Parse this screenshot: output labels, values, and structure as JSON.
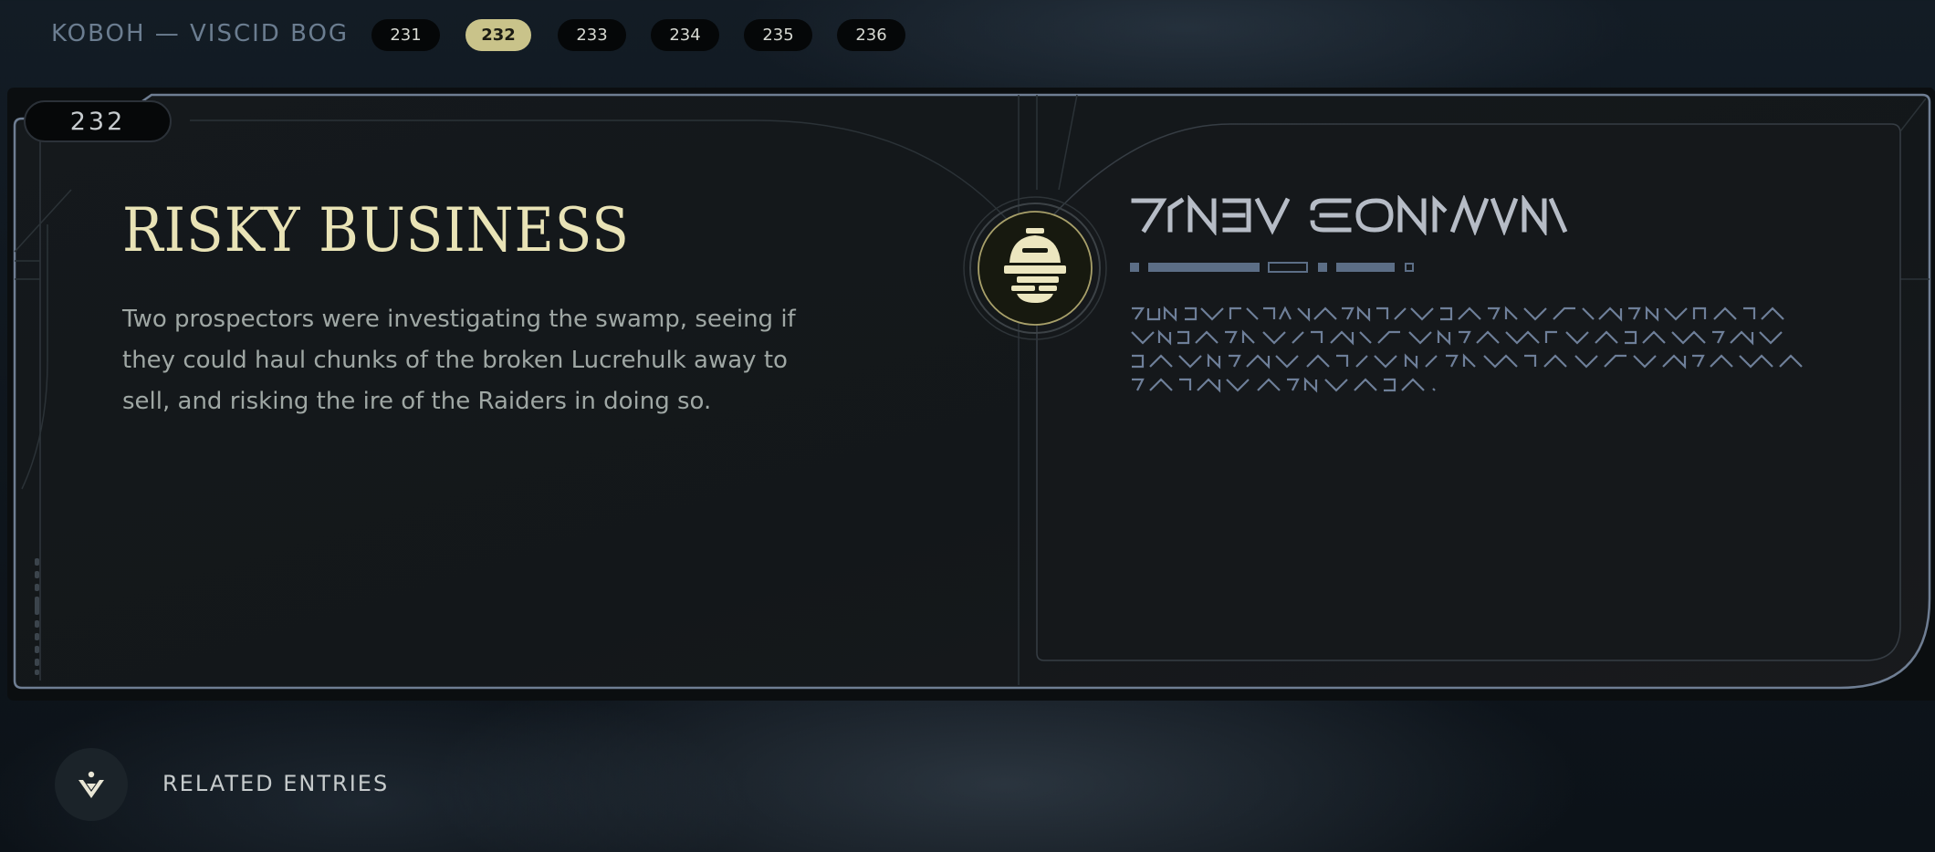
{
  "nav": {
    "location": "KOBOH — VISCID BOG",
    "entries": [
      "231",
      "232",
      "233",
      "234",
      "235",
      "236"
    ],
    "active_entry": "232"
  },
  "entry": {
    "number": "232",
    "title": "RISKY BUSINESS",
    "description": "Two prospectors were investigating the swamp, seeing if they could haul chunks of the broken Lucrehulk away to sell, and risking the ire of the Raiders in doing so.",
    "emblem_icon": "droid-head-icon"
  },
  "related": {
    "label": "RELATED ENTRIES",
    "icon": "jedi-order-icon"
  },
  "colors": {
    "accent": "#c9c38a",
    "title": "#e9e3b6",
    "body_text": "#9fa7a4",
    "alien_text": "#7e8ea7",
    "frame": "#6f7e93",
    "panel_bg": "#14181b"
  }
}
